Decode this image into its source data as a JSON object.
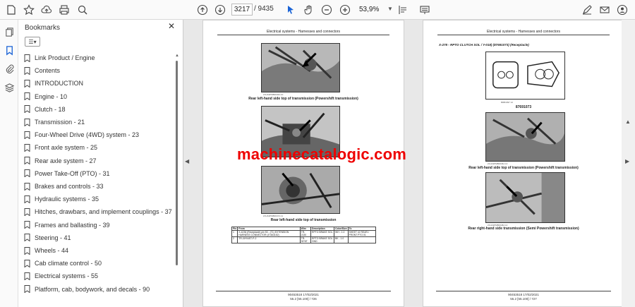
{
  "toolbar": {
    "page_current": "3217",
    "page_total": "/ 9435",
    "zoom": "53,9%",
    "icons": [
      "star-icon",
      "cloud-upload-icon",
      "print-icon",
      "zoom-search-icon",
      "arrow-up-icon",
      "arrow-down-icon",
      "cursor-icon",
      "hand-icon",
      "zoom-out-icon",
      "zoom-in-icon",
      "fit-page-icon",
      "keyboard-icon",
      "sign-icon",
      "mail-icon",
      "user-icon"
    ]
  },
  "left_rail": {
    "icons": [
      "pages-icon",
      "bookmark-icon",
      "attachment-icon",
      "layers-icon"
    ]
  },
  "bookmarks_panel": {
    "title": "Bookmarks",
    "items": [
      "Link Product / Engine",
      "Contents",
      "INTRODUCTION",
      "Engine - 10",
      "Clutch - 18",
      "Transmission - 21",
      "Four-Wheel Drive (4WD) system - 23",
      "Front axle system - 25",
      "Rear axle system - 27",
      "Power Take-Off (PTO) - 31",
      "Brakes and controls - 33",
      "Hydraulic systems - 35",
      "Hitches, drawbars, and implement couplings - 37",
      "Frames and ballasting - 39",
      "Steering - 41",
      "Wheels - 44",
      "Cab climate control - 50",
      "Electrical systems - 55",
      "Platform, cab, bodywork, and decals - 90"
    ]
  },
  "page_left": {
    "header": "Electrical systems - Harnesses and connectors",
    "photo1_id": "ZJUA3PMB0046A   10",
    "caption1": "Rear left-hand side top of transmission (Powershift transmission)",
    "photo2_id": "ZJUA3PMB0047A   11",
    "caption2": "Rear left-hand side top of transmission",
    "table": {
      "headers": [
        "Pin",
        "From",
        "Wire",
        "Description",
        "Color/Size",
        "To"
      ],
      "rows": [
        [
          "1",
          "X-4236 (Receptacle) pin 53 - (T1) EXTENSION HARNESS CONNECTOR (47463152)",
          "TR-2130",
          "RPTO BRAKE SOL",
          "WH - 1.0",
          "SHEET 42 REAR-/ FRONT PTO 01"
        ],
        [
          "2",
          "TR-30*04ST-P-2",
          "TR-30*6T",
          "RPTO BRAKE SOL GND",
          "BK - 1.0",
          ""
        ]
      ]
    },
    "footer1": "90453518 17/02/2021",
    "footer2": "55.2 [55.100] / 726"
  },
  "page_right": {
    "header": "Electrical systems - Harnesses and connectors",
    "section_title": "X-278 - RPTO CLUTCH SOL / Y-018) (87691073) (Receptacle)",
    "photo1_id": "BRB4097   12",
    "part_number": "87691073",
    "photo2_id": "ZJUA3PMB0046A   13",
    "caption2": "Rear left-hand side top of transmission (Powershift transmission)",
    "photo3_id": "ZJUA3PMB0048A   14",
    "caption3": "Rear right-hand side transmission (Semi Powershift transmission)",
    "footer1": "90453518 17/02/2021",
    "footer2": "55.2 [55.100] / 727"
  },
  "watermark": "machinecatalogic.com",
  "colors": {
    "accent": "#1a63d6",
    "watermark": "#e00000"
  }
}
